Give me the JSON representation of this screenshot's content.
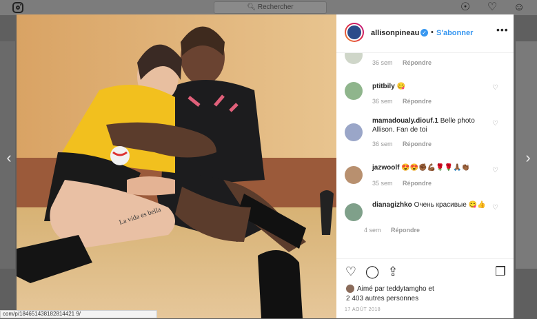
{
  "topbar": {
    "search_placeholder": "Rechercher"
  },
  "post": {
    "username": "allisonpineau",
    "follow_label": "S'abonner",
    "separator": "•",
    "more_label": "•••",
    "liked_by_line1": "Aimé par teddytamgho et",
    "liked_by_line2": "2 403 autres personnes",
    "date": "17 AOÛT 2018"
  },
  "comments": [
    {
      "user": "",
      "text": "",
      "time": "36 sem",
      "reply": "Répondre"
    },
    {
      "user": "ptitbily",
      "text": "😋",
      "time": "36 sem",
      "reply": "Répondre"
    },
    {
      "user": "mamadoualy.diouf.1",
      "text": "Belle photo Allison. Fan de toi",
      "time": "36 sem",
      "reply": "Répondre"
    },
    {
      "user": "jazwoolf",
      "text": "😍😍✊🏾💪🏾🌹🌹🙏🏾👏🏾",
      "time": "35 sem",
      "reply": "Répondre"
    },
    {
      "user": "dianagizhko",
      "text": "Очень красивые 😋👍",
      "time": "4 sem",
      "reply": "Répondre"
    }
  ],
  "status_url": "com/p/184651438182814421 9/",
  "icons": {
    "search": "search-icon",
    "compass": "compass-icon",
    "heart": "heart-icon",
    "profile": "profile-icon"
  }
}
